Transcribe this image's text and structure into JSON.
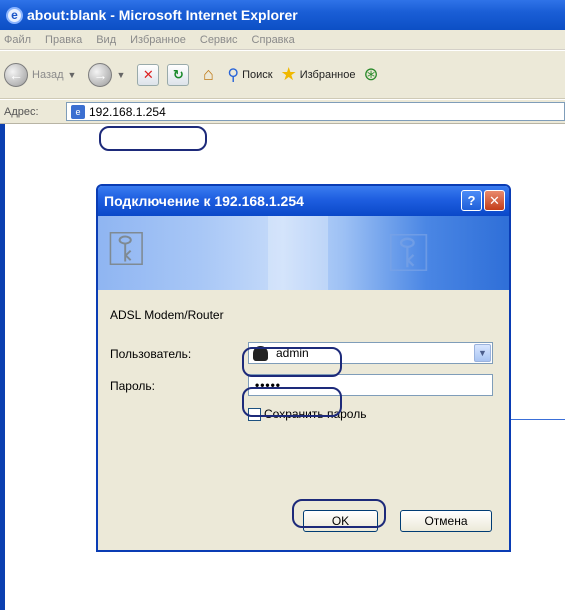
{
  "window": {
    "title": "about:blank - Microsoft Internet Explorer"
  },
  "menu": [
    "Файл",
    "Правка",
    "Вид",
    "Избранное",
    "Сервис",
    "Справка"
  ],
  "toolbar": {
    "back": "Назад",
    "search": "Поиск",
    "favorites": "Избранное"
  },
  "address": {
    "label": "Адрес:",
    "value": "192.168.1.254"
  },
  "dialog": {
    "title": "Подключение к 192.168.1.254",
    "realm": "ADSL Modem/Router",
    "user_label": "Пользователь:",
    "user_value": "admin",
    "password_label": "Пароль:",
    "password_value": "•••••",
    "remember_label": "Сохранить пароль",
    "ok": "OK",
    "cancel": "Отмена"
  }
}
